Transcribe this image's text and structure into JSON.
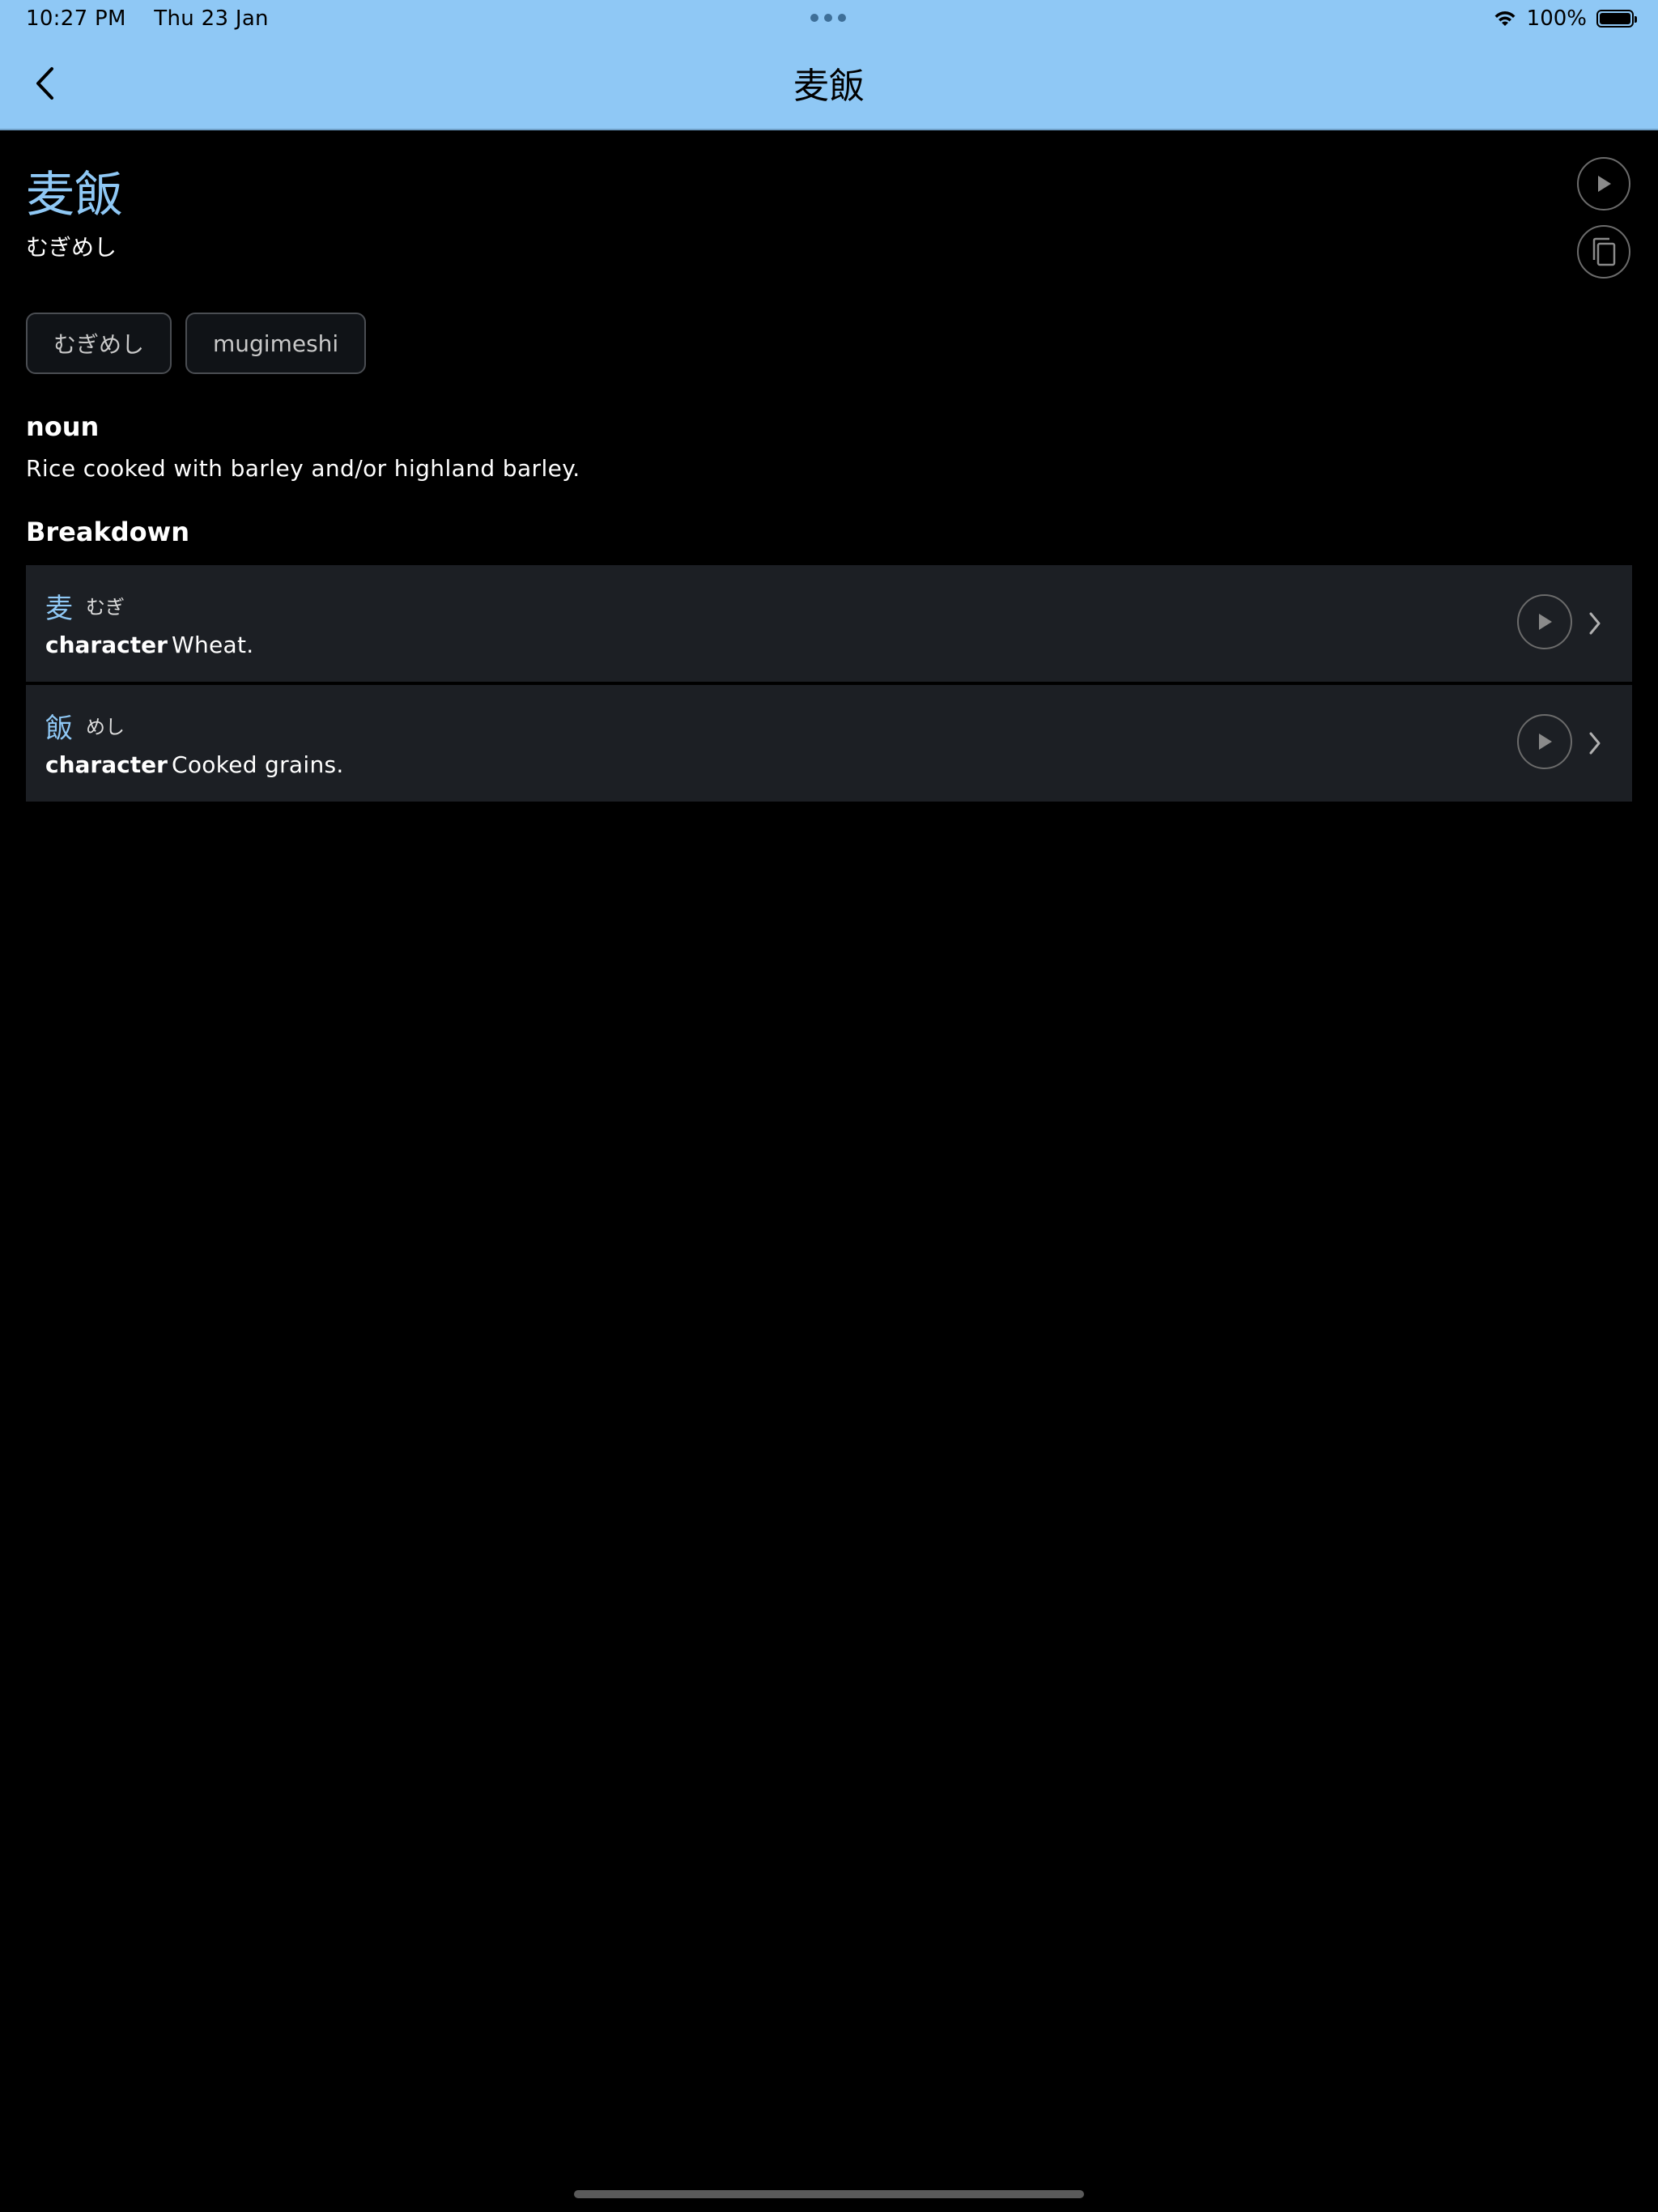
{
  "status_bar": {
    "time": "10:27 PM",
    "date": "Thu 23 Jan",
    "battery": "100%",
    "battery_level": 1.0
  },
  "nav": {
    "title": "麦飯",
    "back_icon": "chevron-left-icon"
  },
  "entry": {
    "word": "麦飯",
    "reading": "むぎめし",
    "tags": [
      "むぎめし",
      "mugimeshi"
    ],
    "part_of_speech": "noun",
    "definition": "Rice cooked with barley and/or highland barley."
  },
  "breakdown": {
    "title": "Breakdown",
    "items": [
      {
        "char": "麦",
        "kana": "むぎ",
        "label": "character",
        "meaning": "Wheat."
      },
      {
        "char": "飯",
        "kana": "めし",
        "label": "character",
        "meaning": "Cooked grains."
      }
    ]
  },
  "colors": {
    "accent": "#8fc8f5",
    "background": "#000000",
    "row_background": "#1c1f24"
  }
}
